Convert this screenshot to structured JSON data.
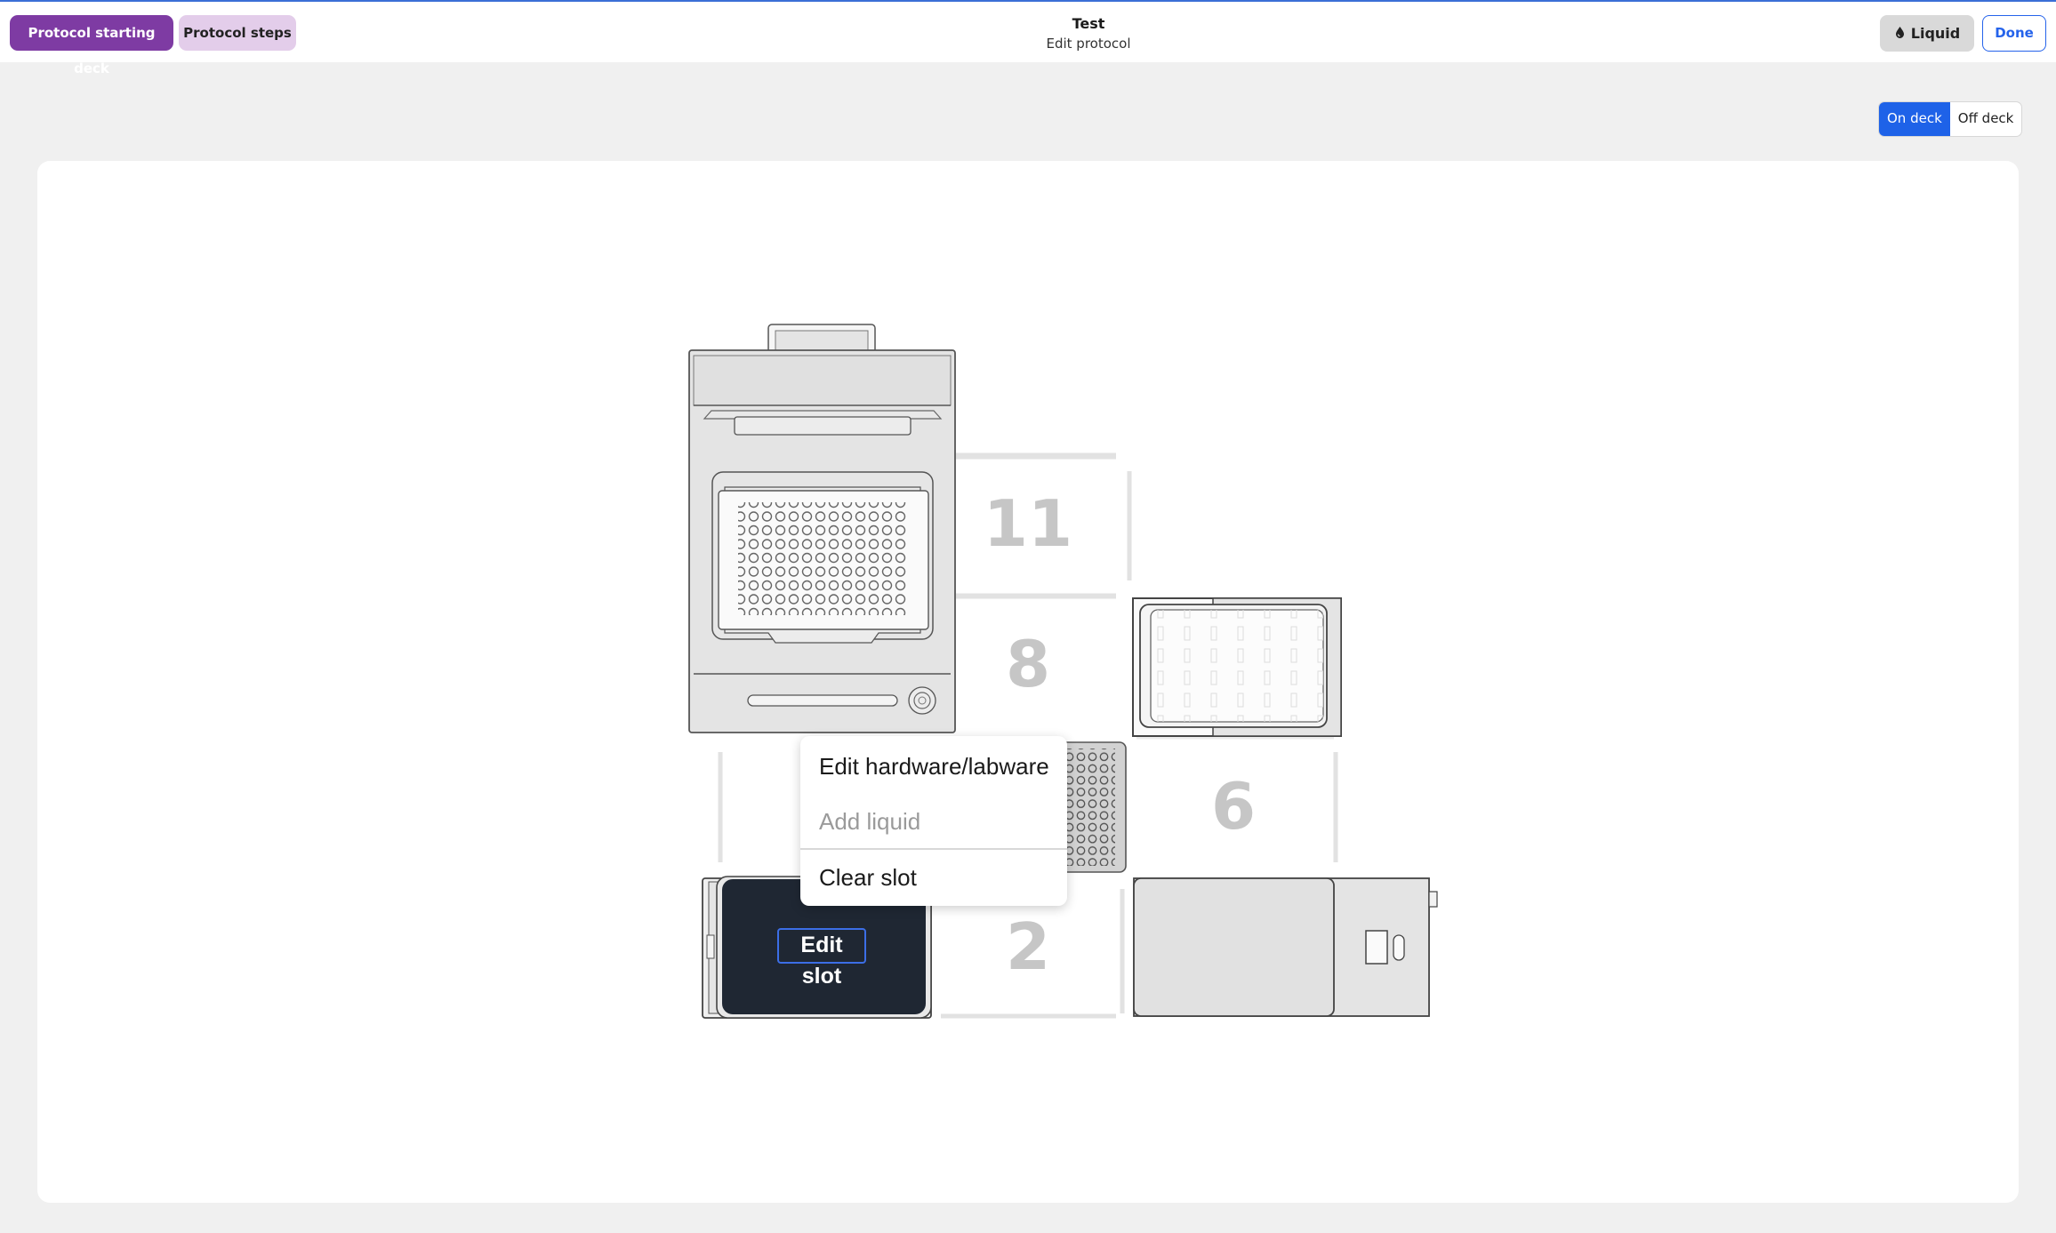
{
  "header": {
    "tabs": [
      {
        "label": "Protocol starting deck",
        "active": true
      },
      {
        "label": "Protocol steps",
        "active": false
      }
    ],
    "title": "Test",
    "subtitle": "Edit protocol",
    "liquid_label": "Liquid",
    "done_label": "Done"
  },
  "view_toggle": {
    "on_deck_label": "On deck",
    "off_deck_label": "Off deck",
    "selected": "On deck"
  },
  "deck": {
    "slot_labels": {
      "slot_11": "11",
      "slot_8": "8",
      "slot_6": "6",
      "slot_2": "2"
    }
  },
  "context_menu": {
    "edit_label": "Edit hardware/labware",
    "add_liquid_label": "Add liquid",
    "clear_label": "Clear slot"
  },
  "overlay": {
    "edit_slot_label": "Edit slot"
  },
  "colors": {
    "accent_purple": "#7e3ba3",
    "light_purple": "#e3cdea",
    "accent_blue": "#1e62e8"
  },
  "icons": {
    "liquid": "droplet-icon"
  }
}
